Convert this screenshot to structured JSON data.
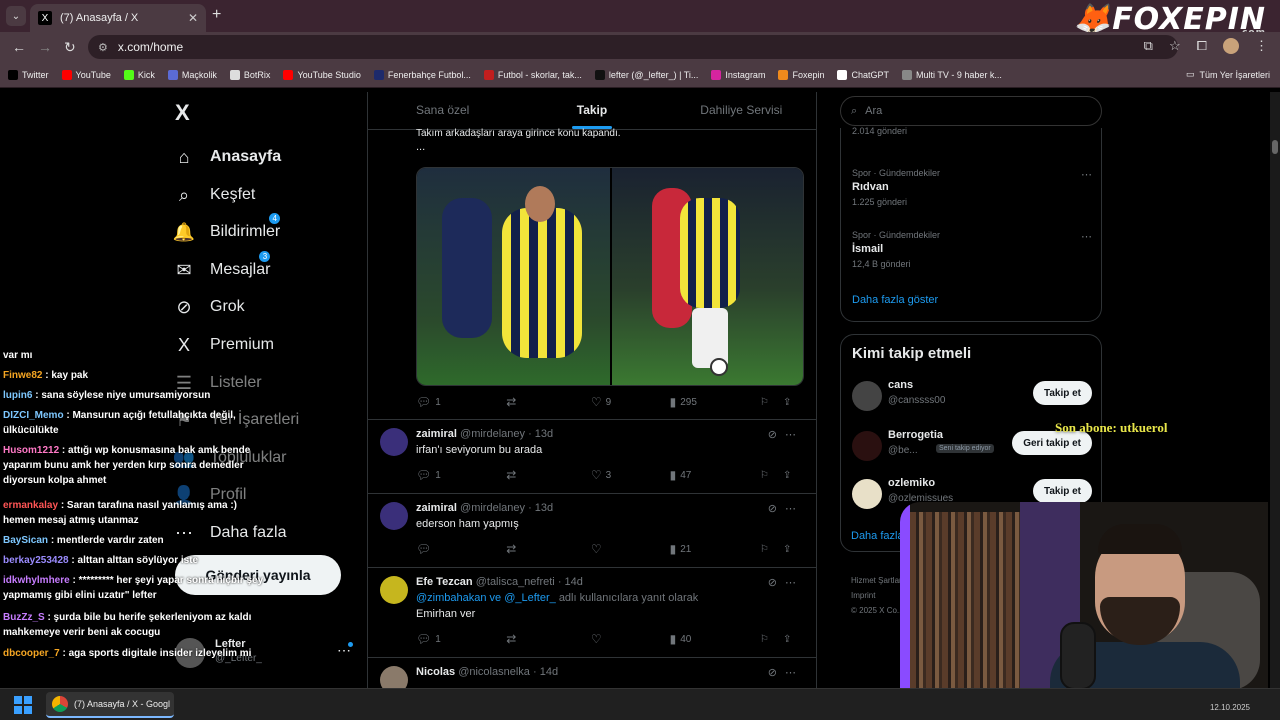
{
  "browser": {
    "tab_title": "(7) Anasayfa / X",
    "tab_close": "✕",
    "new_tab": "+",
    "url": "x.com/home",
    "brand_logo": "FOXEPIN",
    "brand_sub": ".com"
  },
  "bookmarks": {
    "items": [
      {
        "label": "Twitter",
        "color": "#000000"
      },
      {
        "label": "YouTube",
        "color": "#ff0000"
      },
      {
        "label": "Kick",
        "color": "#53fc18"
      },
      {
        "label": "Maçkolik",
        "color": "#5b6bd6"
      },
      {
        "label": "BotRix",
        "color": "#dddddd"
      },
      {
        "label": "YouTube Studio",
        "color": "#ff0000"
      },
      {
        "label": "Fenerbahçe Futbol...",
        "color": "#1d2a6b"
      },
      {
        "label": "Futbol - skorlar, tak...",
        "color": "#c21e1e"
      },
      {
        "label": "lefter (@_lefter_) | Ti...",
        "color": "#111111"
      },
      {
        "label": "Instagram",
        "color": "#d6249f"
      },
      {
        "label": "Foxepin",
        "color": "#f08a1c"
      },
      {
        "label": "ChatGPT",
        "color": "#ffffff"
      },
      {
        "label": "Multi TV - 9 haber k...",
        "color": "#888888"
      }
    ],
    "all_bookmarks": "Tüm Yer İşaretleri"
  },
  "leftnav": {
    "logo": "X",
    "items": [
      {
        "label": "Anasayfa",
        "icon": "⌂",
        "bold": true
      },
      {
        "label": "Keşfet",
        "icon": "⌕"
      },
      {
        "label": "Bildirimler",
        "icon": "🔔",
        "badge": "4"
      },
      {
        "label": "Mesajlar",
        "icon": "✉",
        "badge": "3"
      },
      {
        "label": "Grok",
        "icon": "⊘"
      },
      {
        "label": "Premium",
        "icon": "X"
      },
      {
        "label": "Listeler",
        "icon": "☰"
      },
      {
        "label": "Yer İşaretleri",
        "icon": "⚑"
      },
      {
        "label": "Topluluklar",
        "icon": "👥"
      },
      {
        "label": "Profil",
        "icon": "👤"
      },
      {
        "label": "Daha fazla",
        "icon": "⋯"
      }
    ],
    "post_button": "Gönderi yayınla",
    "account_name": "Lefter",
    "account_handle": "@_Lefter_",
    "account_more": "⋯"
  },
  "chat": [
    {
      "user": "",
      "text": "var mı",
      "color": "#ffffff"
    },
    {
      "user": "Finwe82",
      "text": ": kay pak",
      "color": "#f5a623"
    },
    {
      "user": "lupin6",
      "text": ": sana söylese niye umursamiyorsun",
      "color": "#7ec8ff"
    },
    {
      "user": "DIZCI_Memo",
      "text": ": Mansurun açığı fetullahçıkta değil, ülkücülükte",
      "color": "#7ec8ff"
    },
    {
      "user": "Husom1212",
      "text": ": attığı wp konusmasına bak amk bende yaparım bunu amk her yerden kırp sonra demedler diyorsun kolpa ahmet",
      "color": "#ff79c6"
    },
    {
      "user": "ermankalay",
      "text": ": Saran tarafına nasıl yanlamış ama :) hemen mesaj atmış utanmaz",
      "color": "#ff5555"
    },
    {
      "user": "BaySican",
      "text": ": mentlerde vardır zaten",
      "color": "#7ec8ff"
    },
    {
      "user": "berkay253428",
      "text": ": alttan alttan söylüyor iste",
      "color": "#9b8cff"
    },
    {
      "user": "idkwhylmhere",
      "text": ": ********* her şeyi yapar sonra hiçbir şey yapmamış gibi elini uzatır\" lefter",
      "color": "#c77dff"
    },
    {
      "user": "BuzZz_S",
      "text": ": şurda bile bu herife şekerleniyom az kaldı mahkemeye verir beni ak cocugu",
      "color": "#c77dff"
    },
    {
      "user": "dbcooper_7",
      "text": ": aga sports digitale insider izleyelim mi",
      "color": "#f5a623"
    }
  ],
  "timeline": {
    "tabs": [
      "Sana özel",
      "Takip",
      "Dahiliye Servisi"
    ],
    "active_tab": 1,
    "partial_text": "Takım arkadaşları araya girince konu kapandı.",
    "partial_ellipsis": "...",
    "tweets": [
      {
        "reply": "1",
        "retweet": "",
        "like": "9",
        "views": "295"
      },
      {
        "name": "zaimiral",
        "handle": "@mirdelaney",
        "time": "· 13d",
        "text": "irfan'ı seviyorum bu arada",
        "reply": "1",
        "retweet": "",
        "like": "3",
        "views": "47"
      },
      {
        "name": "zaimiral",
        "handle": "@mirdelaney",
        "time": "· 13d",
        "text": "ederson ham yapmış",
        "reply": "",
        "retweet": "",
        "like": "",
        "views": "21"
      },
      {
        "name": "Efe Tezcan",
        "handle": "@talisca_nefreti",
        "time": "· 14d",
        "reply_to_a": "@zimbahakan ve @_Lefter_",
        "reply_to_b": "adlı kullanıcılara yanıt olarak",
        "text": "Emirhan ver",
        "reply": "1",
        "retweet": "",
        "like": "",
        "views": "40"
      },
      {
        "name": "Nicolas",
        "handle": "@nicolasnelka",
        "time": "· 14d"
      }
    ]
  },
  "right": {
    "search_placeholder": "Ara",
    "trends": [
      {
        "category": "",
        "name": "",
        "count": "2.014 gönderi"
      },
      {
        "category": "Spor · Gündemdekiler",
        "name": "Rıdvan",
        "count": "1.225 gönderi"
      },
      {
        "category": "Spor · Gündemdekiler",
        "name": "İsmail",
        "count": "12,4 B gönderi"
      }
    ],
    "show_more": "Daha fazla göster",
    "who_title": "Kimi takip etmeli",
    "who": [
      {
        "name": "cans",
        "handle": "@canssss00",
        "button": "Takip et"
      },
      {
        "name": "Berrogetia",
        "handle": "@be...",
        "pill": "Seni takip ediyor",
        "button": "Geri takip et"
      },
      {
        "name": "ozlemiko",
        "handle": "@ozlemissues",
        "button": "Takip et"
      }
    ],
    "show_more_2": "Daha fazla",
    "footer_1": "Hizmet Şartları",
    "footer_2": "Imprint",
    "footer_3": "© 2025 X Co..."
  },
  "overlay": {
    "sub_text": "Son abone: utkuerol"
  },
  "taskbar": {
    "app_label": "(7) Anasayfa / X - Googl",
    "clock": "12.10.2025"
  }
}
